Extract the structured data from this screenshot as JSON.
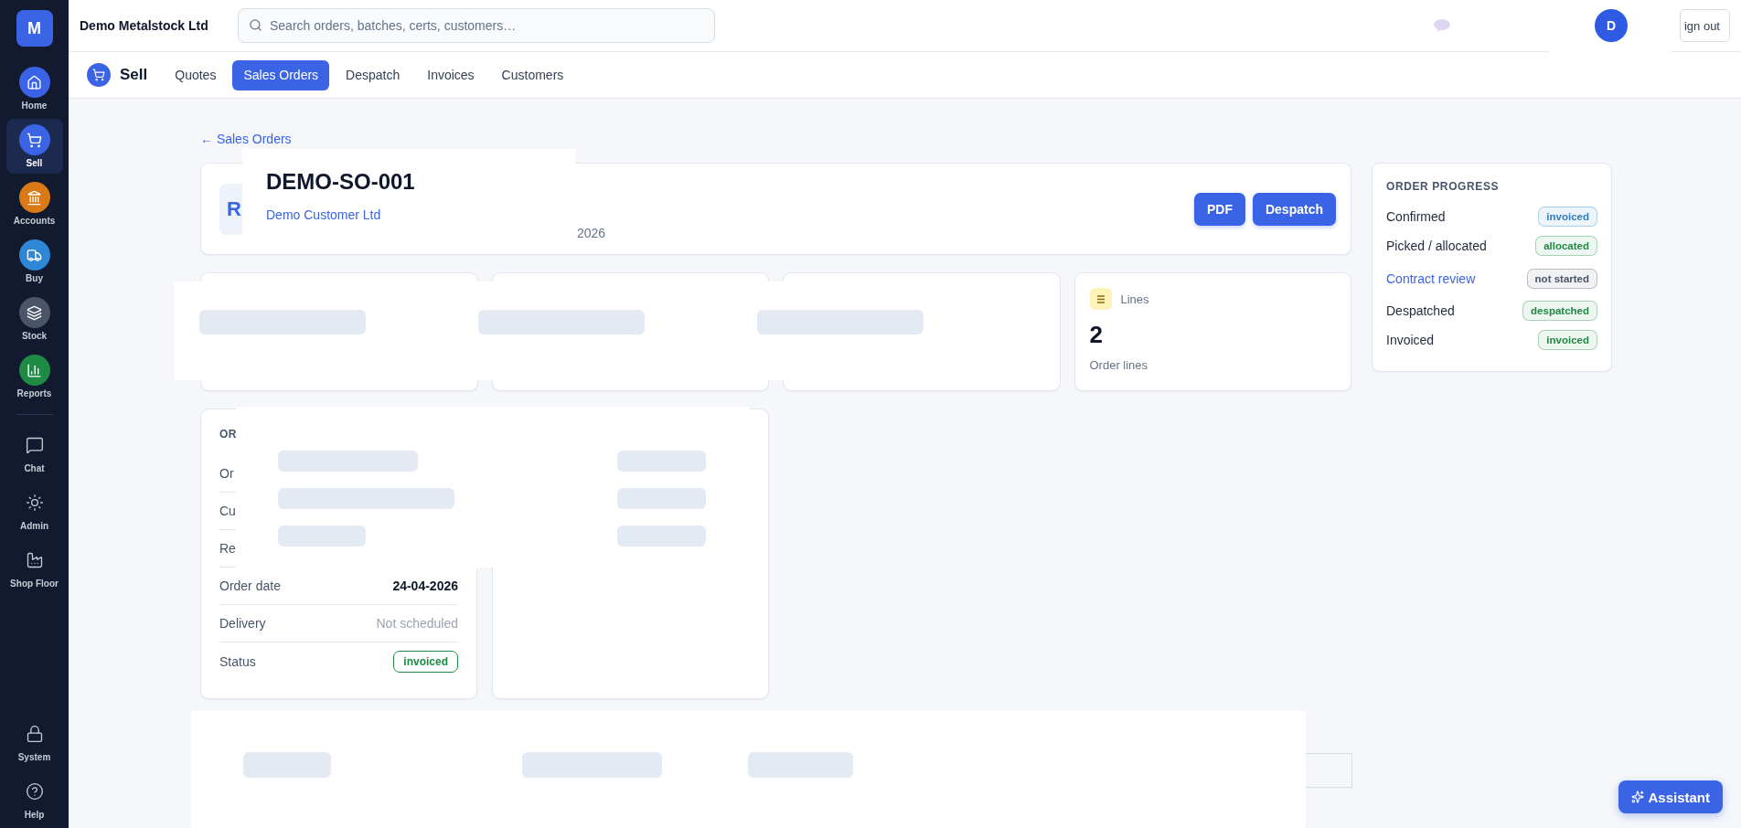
{
  "app": {
    "logo": "M",
    "company": "Demo Metalstock Ltd"
  },
  "search": {
    "placeholder": "Search orders, batches, certs, customers…"
  },
  "user": {
    "initial": "D",
    "sign_out": "ign out"
  },
  "sidebar": {
    "main": [
      {
        "label": "Home",
        "color": "#3b63e6",
        "selected": false
      },
      {
        "label": "Sell",
        "color": "#3b63e6",
        "selected": true
      },
      {
        "label": "Accounts",
        "color": "#d97a16",
        "selected": false
      },
      {
        "label": "Buy",
        "color": "#2e86d4",
        "selected": false
      },
      {
        "label": "Stock",
        "color": "#4b5568",
        "selected": false
      },
      {
        "label": "Reports",
        "color": "#1f8a43",
        "selected": false
      }
    ],
    "tools": [
      {
        "label": "Chat",
        "selected": false
      },
      {
        "label": "Admin",
        "selected": false
      },
      {
        "label": "Shop Floor",
        "selected": false
      }
    ],
    "bottom": [
      {
        "label": "System",
        "selected": false
      },
      {
        "label": "Help",
        "selected": false
      }
    ]
  },
  "section": {
    "title": "Sell",
    "tabs": [
      {
        "label": "Quotes",
        "selected": false
      },
      {
        "label": "Sales Orders",
        "selected": true
      },
      {
        "label": "Despatch",
        "selected": false
      },
      {
        "label": "Invoices",
        "selected": false
      },
      {
        "label": "Customers",
        "selected": false
      }
    ]
  },
  "back_link": "← Sales Orders",
  "order": {
    "avatar": "R",
    "number": "DEMO-SO-001",
    "customer": "Demo Customer Ltd",
    "meta": "2026",
    "buttons": [
      "PDF",
      "Despatch"
    ]
  },
  "stats": [
    {
      "kind": "loading"
    },
    {
      "kind": "loading"
    },
    {
      "kind": "loading"
    },
    {
      "kind": "stat",
      "label": "Lines",
      "value": "2",
      "caption": "Order lines"
    }
  ],
  "details": {
    "title": "OR",
    "rows": [
      {
        "label": "Or",
        "kind": "covered"
      },
      {
        "label": "Cu",
        "kind": "covered"
      },
      {
        "label": "Re",
        "kind": "covered"
      },
      {
        "label": "Order date",
        "kind": "text",
        "value": "24-04-2026"
      },
      {
        "label": "Delivery",
        "kind": "muted",
        "value": "Not scheduled"
      },
      {
        "label": "Status",
        "kind": "badge",
        "value": "invoiced"
      }
    ]
  },
  "progress": {
    "title": "ORDER PROGRESS",
    "items": [
      {
        "label": "Confirmed",
        "badge": "invoiced",
        "color": "#2b7dc2",
        "link": false
      },
      {
        "label": "Picked / allocated",
        "badge": "allocated",
        "color": "#1f8a43",
        "link": false
      },
      {
        "label": "Contract review",
        "badge": "not started",
        "color": "#475569",
        "link": true
      },
      {
        "label": "Despatched",
        "badge": "despatched",
        "color": "#1f8a43",
        "link": false
      },
      {
        "label": "Invoiced",
        "badge": "invoiced",
        "color": "#1f8a43",
        "link": false
      }
    ]
  },
  "assistant": {
    "label": "Assistant"
  }
}
